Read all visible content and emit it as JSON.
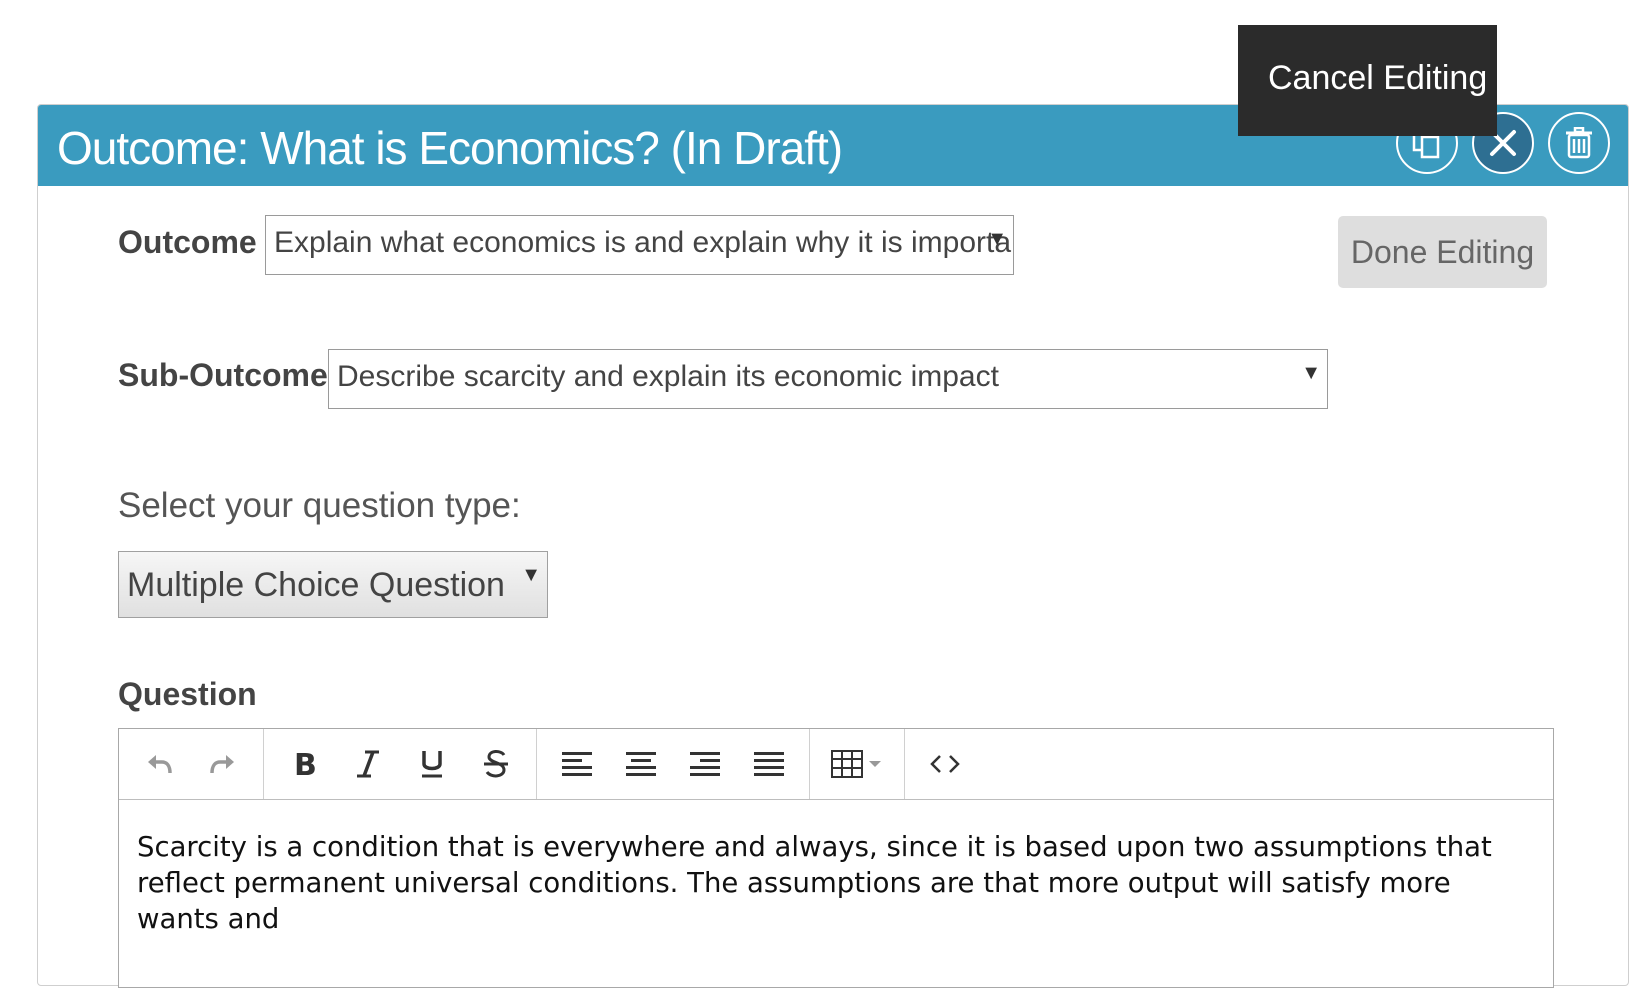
{
  "header": {
    "title": "Outcome: What is Economics? (In Draft)",
    "tooltip": "Cancel Editing"
  },
  "form": {
    "outcome_label": "Outcome",
    "outcome_value": "Explain what economics is and explain why it is important",
    "done_button": "Done Editing",
    "sub_outcome_label": "Sub-Outcome",
    "sub_outcome_value": "Describe scarcity and explain its economic impact",
    "question_type_label": "Select your question type:",
    "question_type_value": "Multiple Choice Question",
    "question_label": "Question"
  },
  "editor": {
    "content": "Scarcity is a condition that is everywhere and always, since it is based upon two assumptions that reflect permanent universal conditions. The assumptions are that more output will satisfy more wants and"
  },
  "colors": {
    "header_bg": "#3a9bbf",
    "close_button_bg": "#2e6f92",
    "tooltip_bg": "#2b2b2b"
  },
  "icons": [
    "copy-icon",
    "close-icon",
    "trash-icon",
    "undo-icon",
    "redo-icon",
    "bold-icon",
    "italic-icon",
    "underline-icon",
    "strikethrough-icon",
    "align-left-icon",
    "align-center-icon",
    "align-right-icon",
    "align-justify-icon",
    "table-icon",
    "code-icon"
  ]
}
